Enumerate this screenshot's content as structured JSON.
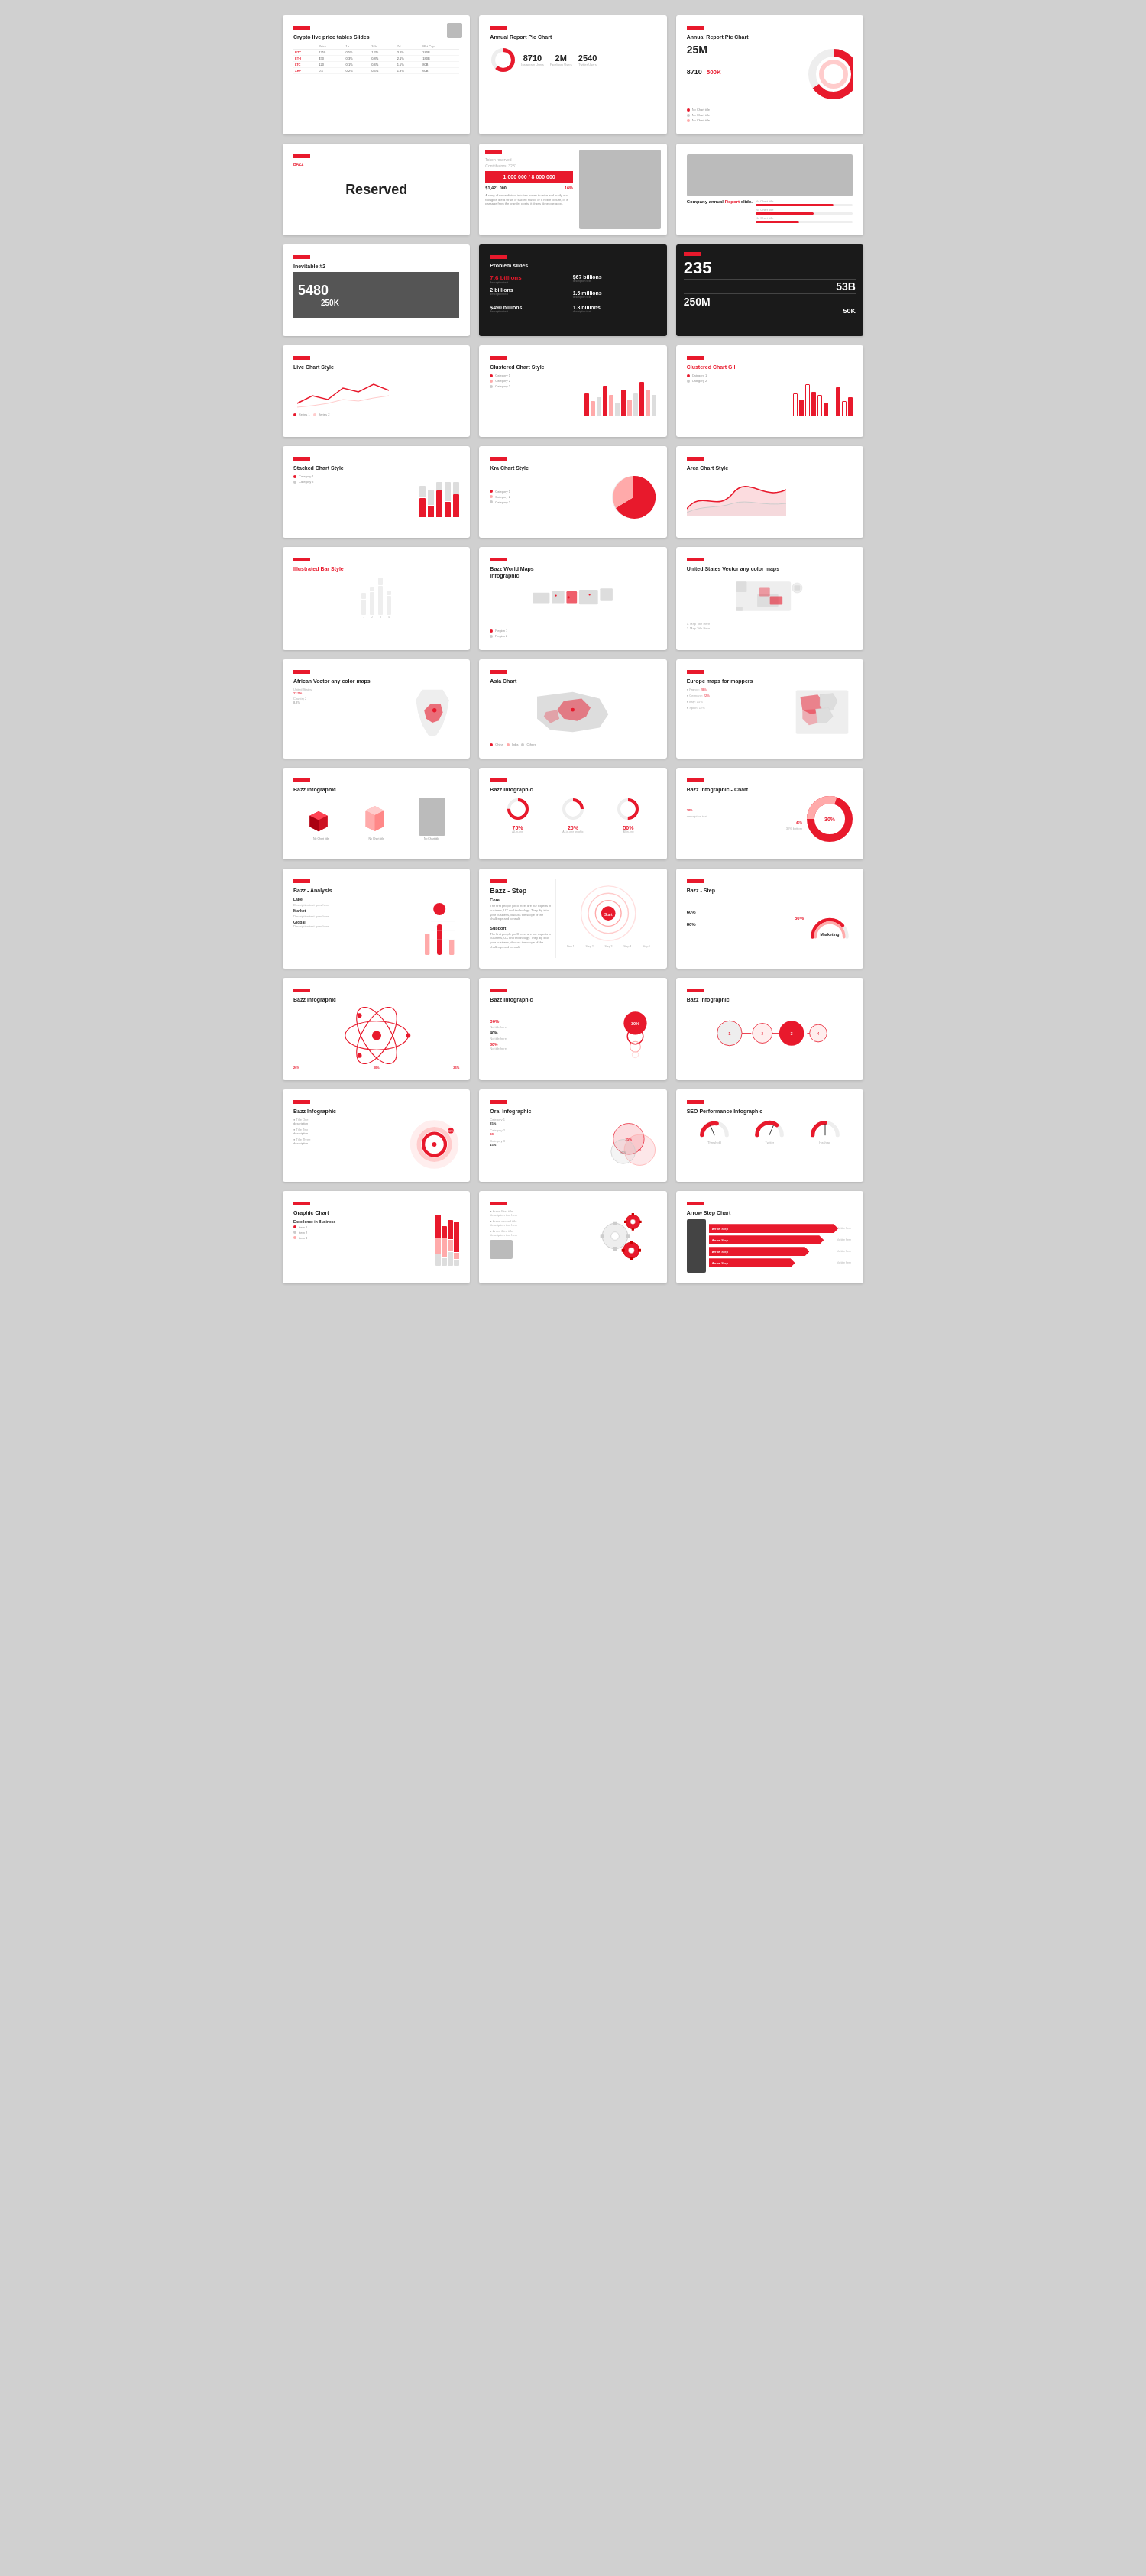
{
  "slides": [
    {
      "id": "slide-1",
      "title": "Crypto live price tables Slides",
      "type": "table",
      "table_headers": [
        "",
        "Price",
        "1h",
        "24h",
        "7d",
        "Market Cap"
      ],
      "table_rows": [
        [
          "BTC",
          "1250",
          "0.5%",
          "1.2%",
          "3.1%",
          "240B"
        ],
        [
          "ETH",
          "450",
          "0.3%",
          "0.8%",
          "2.1%",
          "180B"
        ],
        [
          "LTC",
          "120",
          "0.1%",
          "0.4%",
          "1.5%",
          "80B"
        ],
        [
          "XRP",
          "0.5",
          "0.2%",
          "0.6%",
          "1.8%",
          "60B"
        ]
      ]
    },
    {
      "id": "slide-2",
      "title": "Annual Report Pie Chart",
      "type": "pie-stats",
      "stats": [
        {
          "value": "8710",
          "label": "Instagram Users"
        },
        {
          "value": "2M",
          "label": "Facebook Users"
        },
        {
          "value": "2540",
          "label": "Twitter Users"
        }
      ]
    },
    {
      "id": "slide-3",
      "title": "Annual Report Pie Chart",
      "type": "donut-big",
      "main_value": "25M",
      "secondary_value": "8710",
      "tertiary_value": "500K"
    },
    {
      "id": "slide-4",
      "title": "Reserved",
      "type": "reserved"
    },
    {
      "id": "slide-5",
      "title": "Token reserved",
      "type": "token",
      "token_progress": "1 000 000 / 8 000 000",
      "contributors": "Contributors: 3281",
      "value": "$1,421.000",
      "percent": "16%"
    },
    {
      "id": "slide-6",
      "title": "Company annual Report slide.",
      "type": "company-report"
    },
    {
      "id": "slide-7",
      "title": "Inevitable #2",
      "type": "inevitable",
      "num1": "5480",
      "num2": "250K"
    },
    {
      "id": "slide-8",
      "title": "Problem slides",
      "type": "problem-dark",
      "stats": [
        {
          "value": "7.6 billions",
          "sub": ""
        },
        {
          "value": "$67 billions",
          "sub": ""
        },
        {
          "value": "2 billions",
          "sub": ""
        },
        {
          "value": "1.5 millions",
          "sub": ""
        },
        {
          "value": "$490 billions",
          "sub": ""
        },
        {
          "value": "1.3 billions",
          "sub": ""
        }
      ]
    },
    {
      "id": "slide-9",
      "title": "235",
      "type": "big-numbers-dark",
      "nums": [
        "235",
        "53B",
        "250M",
        "50K"
      ]
    },
    {
      "id": "slide-10",
      "title": "Live Chart Style",
      "type": "line-chart"
    },
    {
      "id": "slide-11",
      "title": "Clustered Chart Style",
      "type": "clustered-bar"
    },
    {
      "id": "slide-12",
      "title": "Clustered Chart Gil",
      "type": "clustered-bar-outline"
    },
    {
      "id": "slide-13",
      "title": "Stacked Chart Style",
      "type": "stacked-bar"
    },
    {
      "id": "slide-14",
      "title": "Kra Chart Style",
      "type": "pie-large"
    },
    {
      "id": "slide-15",
      "title": "Area Chart Style",
      "type": "area-chart"
    },
    {
      "id": "slide-16",
      "title": "Illustrated Bar Style",
      "type": "illustrated-bar"
    },
    {
      "id": "slide-17",
      "title": "Bazz World Maps Infographic",
      "type": "world-map"
    },
    {
      "id": "slide-18",
      "title": "United States Vector any color maps",
      "type": "us-map"
    },
    {
      "id": "slide-19",
      "title": "African Vector any color maps",
      "type": "africa-map"
    },
    {
      "id": "slide-20",
      "title": "Asia Chart",
      "type": "asia-map"
    },
    {
      "id": "slide-21",
      "title": "Europe maps for mappers",
      "type": "europe-map"
    },
    {
      "id": "slide-22",
      "title": "Bazz Infographic",
      "type": "infographic-boxes"
    },
    {
      "id": "slide-23",
      "title": "Bazz Infographic",
      "type": "infographic-circles",
      "stats": [
        {
          "value": "75%",
          "label": ""
        },
        {
          "value": "25%",
          "label": "All-in-one graphic"
        },
        {
          "value": "50%",
          "label": ""
        }
      ]
    },
    {
      "id": "slide-24",
      "title": "Bazz Infographic - Chart",
      "type": "donut-infographic"
    },
    {
      "id": "slide-25",
      "title": "Bazz - Analysis",
      "type": "analysis"
    },
    {
      "id": "slide-26",
      "title": "Bazz - Step",
      "type": "step-wide",
      "steps": [
        "Start",
        "Step 1",
        "Step 2",
        "Step 3",
        "Step 4",
        "Step 5"
      ],
      "sections": [
        "Core",
        "Support"
      ]
    },
    {
      "id": "slide-27",
      "title": "Bazz - Step",
      "type": "step-right",
      "stats": [
        "60%",
        "50%",
        "80%"
      ],
      "label": "Marketing"
    },
    {
      "id": "slide-28",
      "title": "Bazz Infographic",
      "type": "atomic"
    },
    {
      "id": "slide-29",
      "title": "Bazz Infographic",
      "type": "circle-flow",
      "percent": "30%"
    },
    {
      "id": "slide-30",
      "title": "Bazz Infographic",
      "type": "connected-circles"
    },
    {
      "id": "slide-31",
      "title": "Bazz Infographic",
      "type": "ring-chart"
    },
    {
      "id": "slide-32",
      "title": "Oral Infographic",
      "type": "venn"
    },
    {
      "id": "slide-33",
      "title": "SEO Performance Infographic",
      "type": "gauge"
    },
    {
      "id": "slide-34",
      "title": "Graphic Chart",
      "type": "graphic-chart"
    },
    {
      "id": "slide-35",
      "title": "",
      "type": "gears"
    },
    {
      "id": "slide-36",
      "title": "Arrow Step Chart",
      "type": "arrow-step"
    }
  ]
}
